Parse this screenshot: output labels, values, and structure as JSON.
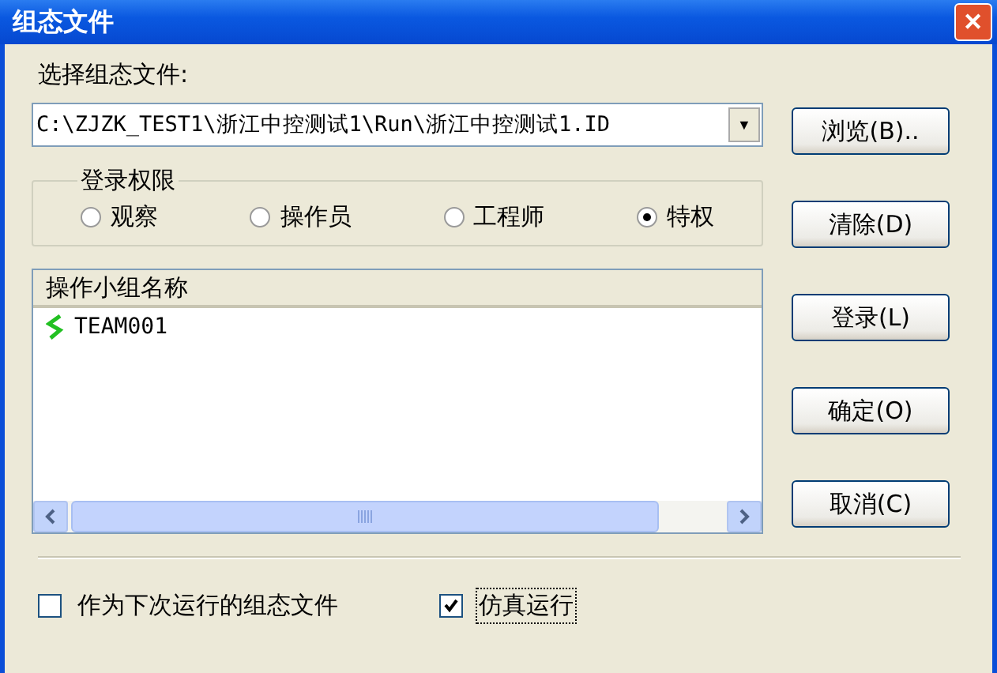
{
  "window": {
    "title": "组态文件",
    "close": "✕"
  },
  "file": {
    "label": "选择组态文件:",
    "value": "C:\\ZJZK_TEST1\\浙江中控测试1\\Run\\浙江中控测试1.ID",
    "dropdown": "▼"
  },
  "rights": {
    "title": "登录权限",
    "options": [
      {
        "label": "观察",
        "selected": false
      },
      {
        "label": "操作员",
        "selected": false
      },
      {
        "label": "工程师",
        "selected": false
      },
      {
        "label": "特权",
        "selected": true
      }
    ]
  },
  "groups": {
    "column": "操作小组名称",
    "rows": [
      {
        "name": "TEAM001"
      }
    ]
  },
  "buttons": [
    "浏览(B)..",
    "清除(D)",
    "登录(L)",
    "确定(O)",
    "取消(C)"
  ],
  "options": [
    {
      "label": "作为下次运行的组态文件",
      "checked": false,
      "focused": false
    },
    {
      "label": "仿真运行",
      "checked": true,
      "focused": true
    }
  ]
}
